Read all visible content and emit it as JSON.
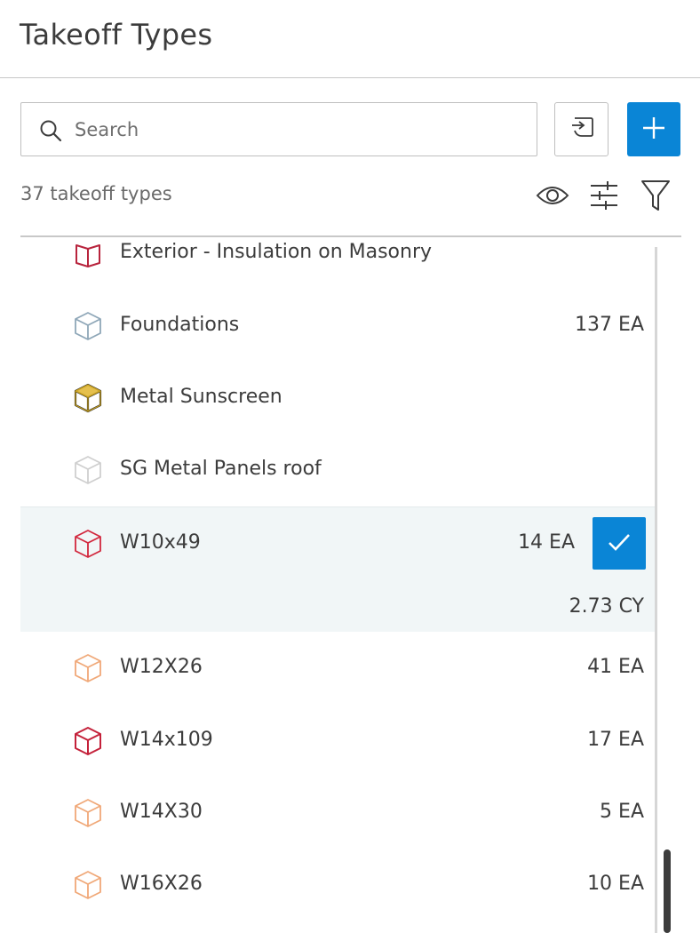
{
  "panel": {
    "title": "Takeoff Types"
  },
  "search": {
    "placeholder": "Search",
    "value": ""
  },
  "summary": {
    "count_text": "37 takeoff types"
  },
  "icons": {
    "search": "search-icon",
    "import": "import-icon",
    "add": "plus-icon",
    "visibility": "eye-icon",
    "settings": "sliders-icon",
    "filter": "funnel-icon",
    "checkmark": "check-icon",
    "item": "cube-icon"
  },
  "colors": {
    "accent": "#0a85d6",
    "selected_row": "#f1f6f7"
  },
  "takeoff_types": [
    {
      "name": "Exterior - Insulation on Masonry",
      "quantity": "",
      "quantity2": "",
      "icon_color": "#b8243d",
      "style": "open-book",
      "selected": false
    },
    {
      "name": "Foundations",
      "quantity": "137 EA",
      "quantity2": "",
      "icon_color": "#8fa7b8",
      "style": "cube",
      "selected": false
    },
    {
      "name": "Metal Sunscreen",
      "quantity": "",
      "quantity2": "",
      "icon_color": "#c9a11c",
      "style": "cube-dark",
      "selected": false
    },
    {
      "name": "SG Metal Panels roof",
      "quantity": "",
      "quantity2": "",
      "icon_color": "#cfcfcf",
      "style": "cube",
      "selected": false
    },
    {
      "name": "W10x49",
      "quantity": "14 EA",
      "quantity2": "2.73 CY",
      "icon_color": "#d2283e",
      "style": "cube",
      "selected": true
    },
    {
      "name": "W12X26",
      "quantity": "41 EA",
      "quantity2": "",
      "icon_color": "#f0a878",
      "style": "cube",
      "selected": false
    },
    {
      "name": "W14x109",
      "quantity": "17 EA",
      "quantity2": "",
      "icon_color": "#c4213a",
      "style": "cube",
      "selected": false
    },
    {
      "name": "W14X30",
      "quantity": "5 EA",
      "quantity2": "",
      "icon_color": "#f0a878",
      "style": "cube",
      "selected": false
    },
    {
      "name": "W16X26",
      "quantity": "10 EA",
      "quantity2": "",
      "icon_color": "#f0a878",
      "style": "cube",
      "selected": false
    }
  ]
}
